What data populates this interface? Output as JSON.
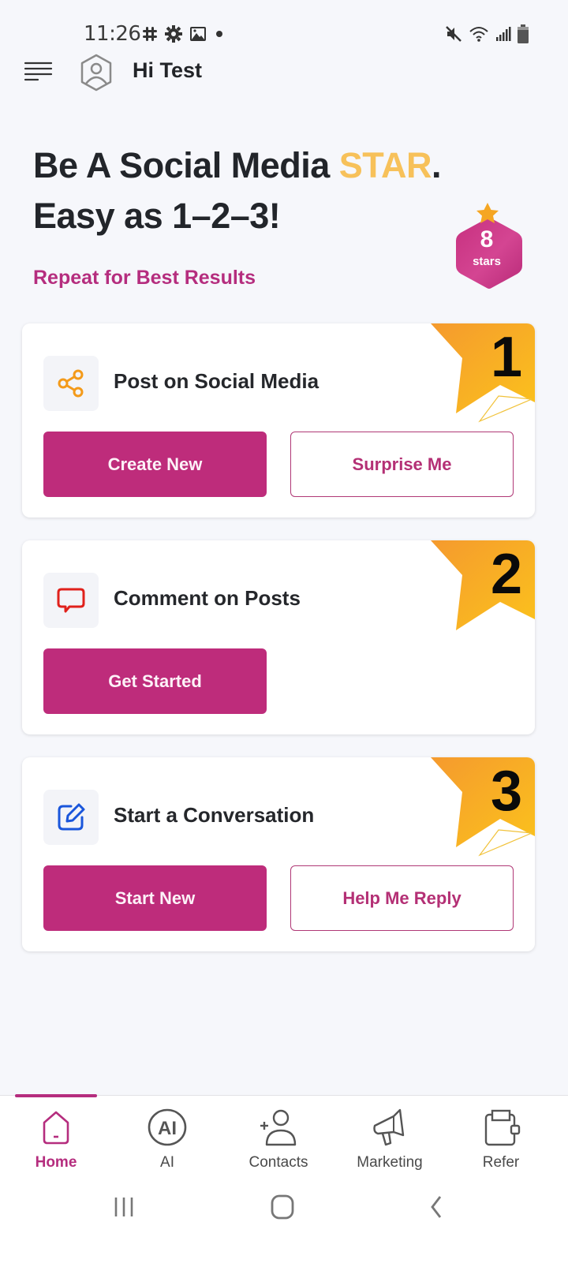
{
  "status_bar": {
    "time": "11:26",
    "left_icons": [
      "slack-icon",
      "settings-icon",
      "gallery-icon",
      "dot-icon"
    ],
    "right_icons": [
      "mute-icon",
      "wifi-icon",
      "signal-icon",
      "battery-icon"
    ]
  },
  "header": {
    "greeting": "Hi Test",
    "menu_icon": "menu-icon",
    "avatar_icon": "user-avatar-icon"
  },
  "hero": {
    "title_part1": "Be A Social Media ",
    "title_highlight": "STAR",
    "title_part2": ".",
    "title_line2": "Easy as 1–2–3!",
    "subtitle": "Repeat for Best Results",
    "highlight_color": "#f7c15a",
    "accent_color": "#b52d7e"
  },
  "badge": {
    "count": "8",
    "label": "stars"
  },
  "cards": [
    {
      "step": "1",
      "title": "Post on Social Media",
      "icon": "share-icon",
      "primary_button": "Create New",
      "secondary_button": "Surprise Me"
    },
    {
      "step": "2",
      "title": "Comment on Posts",
      "icon": "comment-icon",
      "primary_button": "Get Started"
    },
    {
      "step": "3",
      "title": "Start a Conversation",
      "icon": "edit-icon",
      "primary_button": "Start New",
      "secondary_button": "Help Me Reply"
    }
  ],
  "bottom_nav": {
    "active": "Home",
    "items": [
      {
        "label": "Home",
        "icon": "home-icon"
      },
      {
        "label": "AI",
        "icon": "ai-icon"
      },
      {
        "label": "Contacts",
        "icon": "add-contact-icon"
      },
      {
        "label": "Marketing",
        "icon": "megaphone-icon"
      },
      {
        "label": "Refer",
        "icon": "wallet-icon"
      }
    ]
  },
  "system_nav": [
    "recents-button",
    "home-button",
    "back-button"
  ],
  "colors": {
    "primary": "#be2c7b",
    "ribbon_start": "#f7a030",
    "ribbon_end": "#fbbf1f",
    "background": "#f6f7fb"
  }
}
